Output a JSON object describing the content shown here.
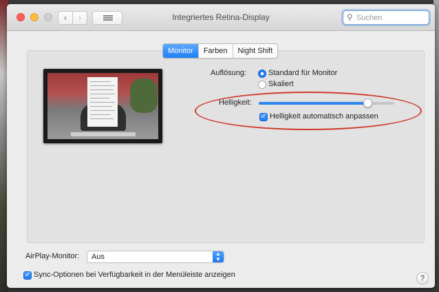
{
  "window": {
    "title": "Integriertes Retina-Display"
  },
  "search": {
    "placeholder": "Suchen",
    "icon": "magnifier-icon"
  },
  "toolbar": {
    "back_glyph": "‹",
    "forward_glyph": "›"
  },
  "tabs": [
    {
      "label": "Monitor",
      "active": true
    },
    {
      "label": "Farben",
      "active": false
    },
    {
      "label": "Night Shift",
      "active": false
    }
  ],
  "resolution": {
    "label": "Auflösung:",
    "options": [
      {
        "label": "Standard für Monitor",
        "selected": true
      },
      {
        "label": "Skaliert",
        "selected": false
      }
    ]
  },
  "brightness": {
    "label": "Helligkeit:",
    "level": 0.8,
    "auto_label": "Helligkeit automatisch anpassen",
    "auto_checked": true
  },
  "airplay": {
    "label": "AirPlay-Monitor:",
    "value": "Aus"
  },
  "sync": {
    "label": "Sync-Optionen bei Verfügbarkeit in der Menüleiste anzeigen",
    "checked": true
  },
  "help": {
    "glyph": "?"
  },
  "colors": {
    "accent": "#1e7cf2",
    "annotation": "#d0392b"
  }
}
